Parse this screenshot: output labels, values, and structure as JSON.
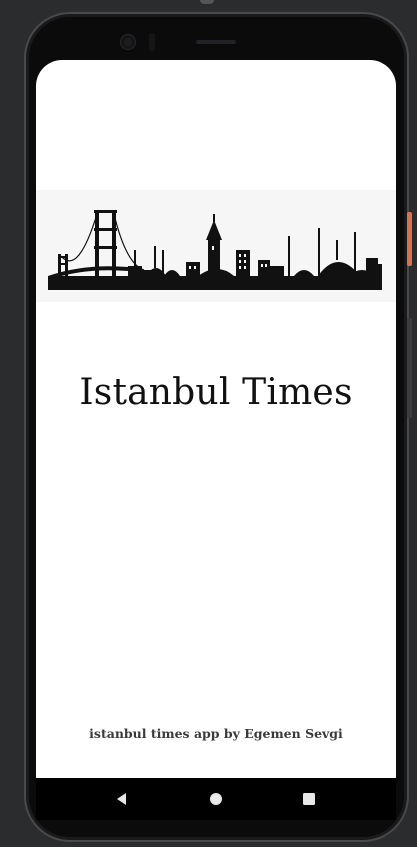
{
  "app": {
    "title": "Istanbul Times",
    "credit": "istanbul times app by Egemen Sevgi"
  },
  "navigation": {
    "back_icon": "back-triangle-icon",
    "home_icon": "home-circle-icon",
    "recents_icon": "recents-square-icon"
  },
  "colors": {
    "screen_background": "#ffffff",
    "skyline_band": "#f6f6f6",
    "skyline": "#111111",
    "power_button": "#d9734f"
  }
}
